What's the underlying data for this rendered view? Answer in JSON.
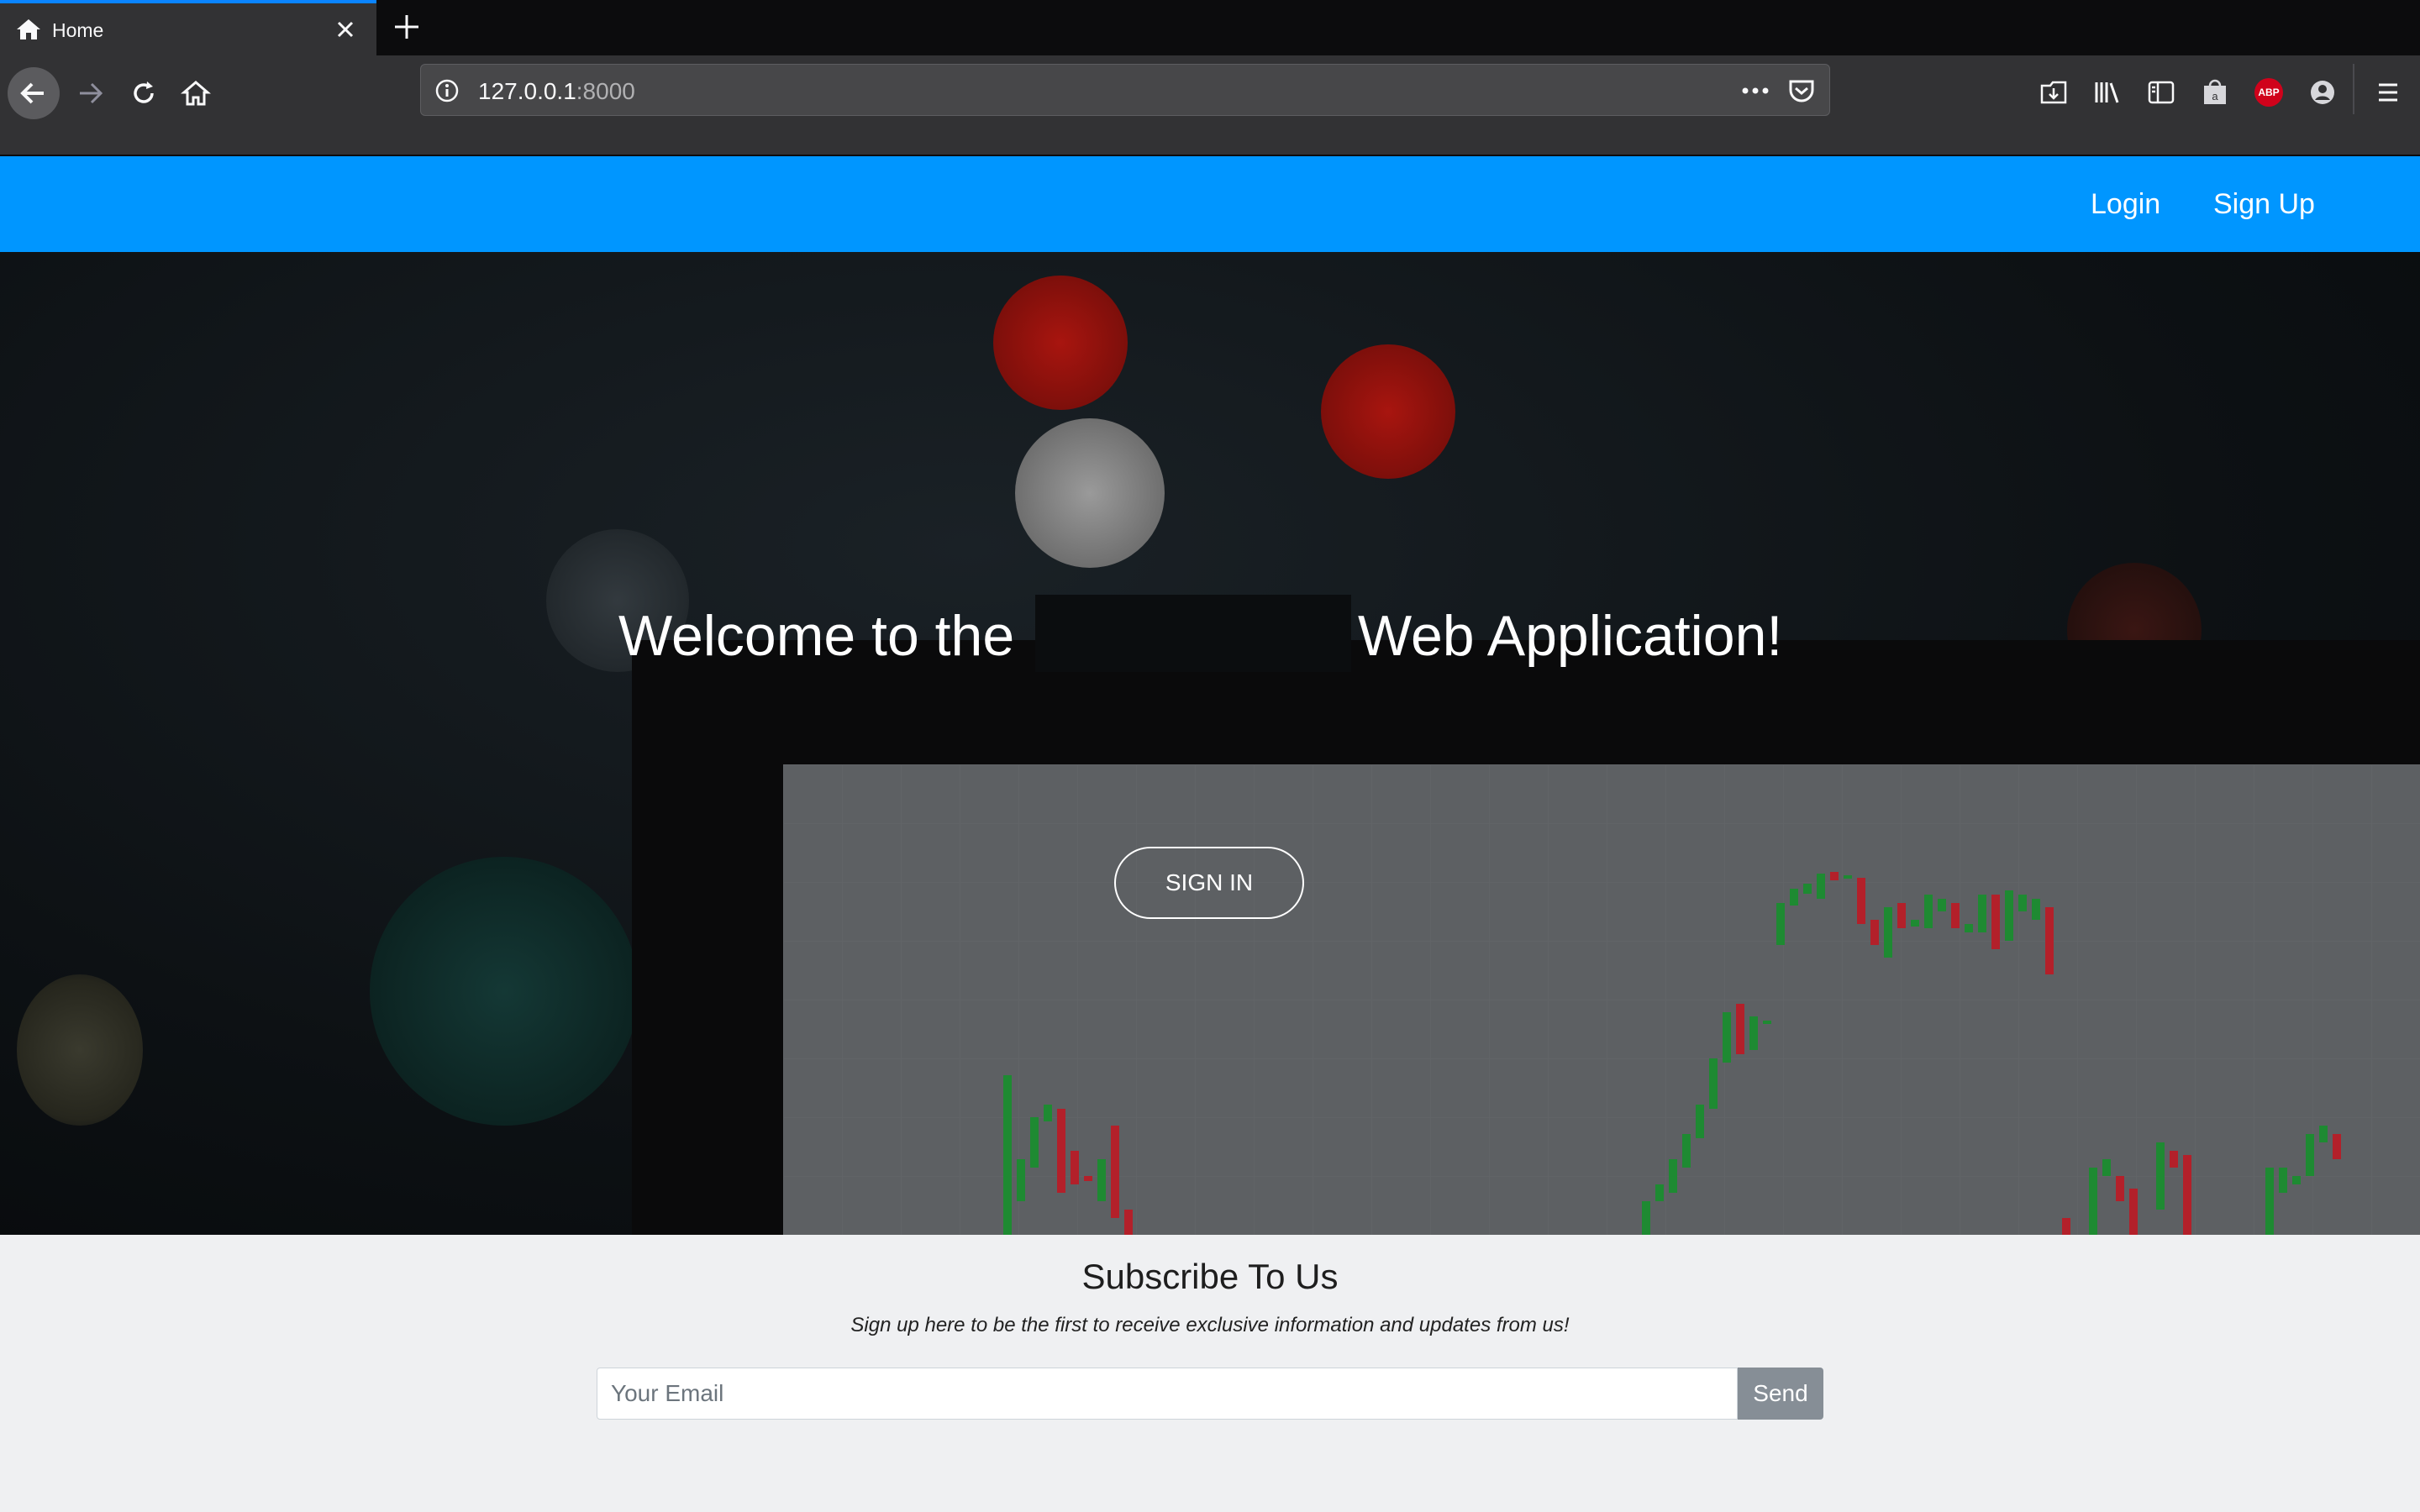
{
  "browser": {
    "tab_title": "Home",
    "url_host": "127.0.0.1",
    "url_port": ":8000",
    "abp_label": "ABP",
    "accent": "#0a84ff"
  },
  "site": {
    "nav": {
      "login_label": "Login",
      "signup_label": "Sign Up",
      "background": "#0096ff"
    },
    "hero": {
      "title_left": "Welcome to the",
      "title_right": "Web Application!",
      "signin_label": "SIGN IN"
    },
    "subscribe": {
      "title": "Subscribe To Us",
      "text": "Sign up here to be the first to receive exclusive information and updates from us!",
      "email_placeholder": "Your Email",
      "send_label": "Send"
    }
  }
}
